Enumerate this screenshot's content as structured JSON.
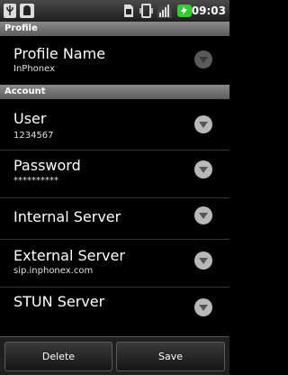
{
  "status_bar": {
    "time": "09:03",
    "icons": [
      "usb-icon",
      "android-icon",
      "sim-icon",
      "vibrate-icon",
      "signal-icon",
      "battery-icon"
    ],
    "accent": "#33cc33"
  },
  "sections": {
    "profile": "Profile",
    "account": "Account"
  },
  "prefs": {
    "profile_name": {
      "title": "Profile Name",
      "summary": "InPhonex"
    },
    "user": {
      "title": "User",
      "summary": "1234567"
    },
    "password": {
      "title": "Password",
      "summary": "**********"
    },
    "internal_server": {
      "title": "Internal Server",
      "summary": ""
    },
    "external_server": {
      "title": "External Server",
      "summary": "sip.inphonex.com"
    },
    "stun_server": {
      "title": "STUN Server",
      "summary": ""
    }
  },
  "buttons": {
    "delete": "Delete",
    "save": "Save"
  }
}
